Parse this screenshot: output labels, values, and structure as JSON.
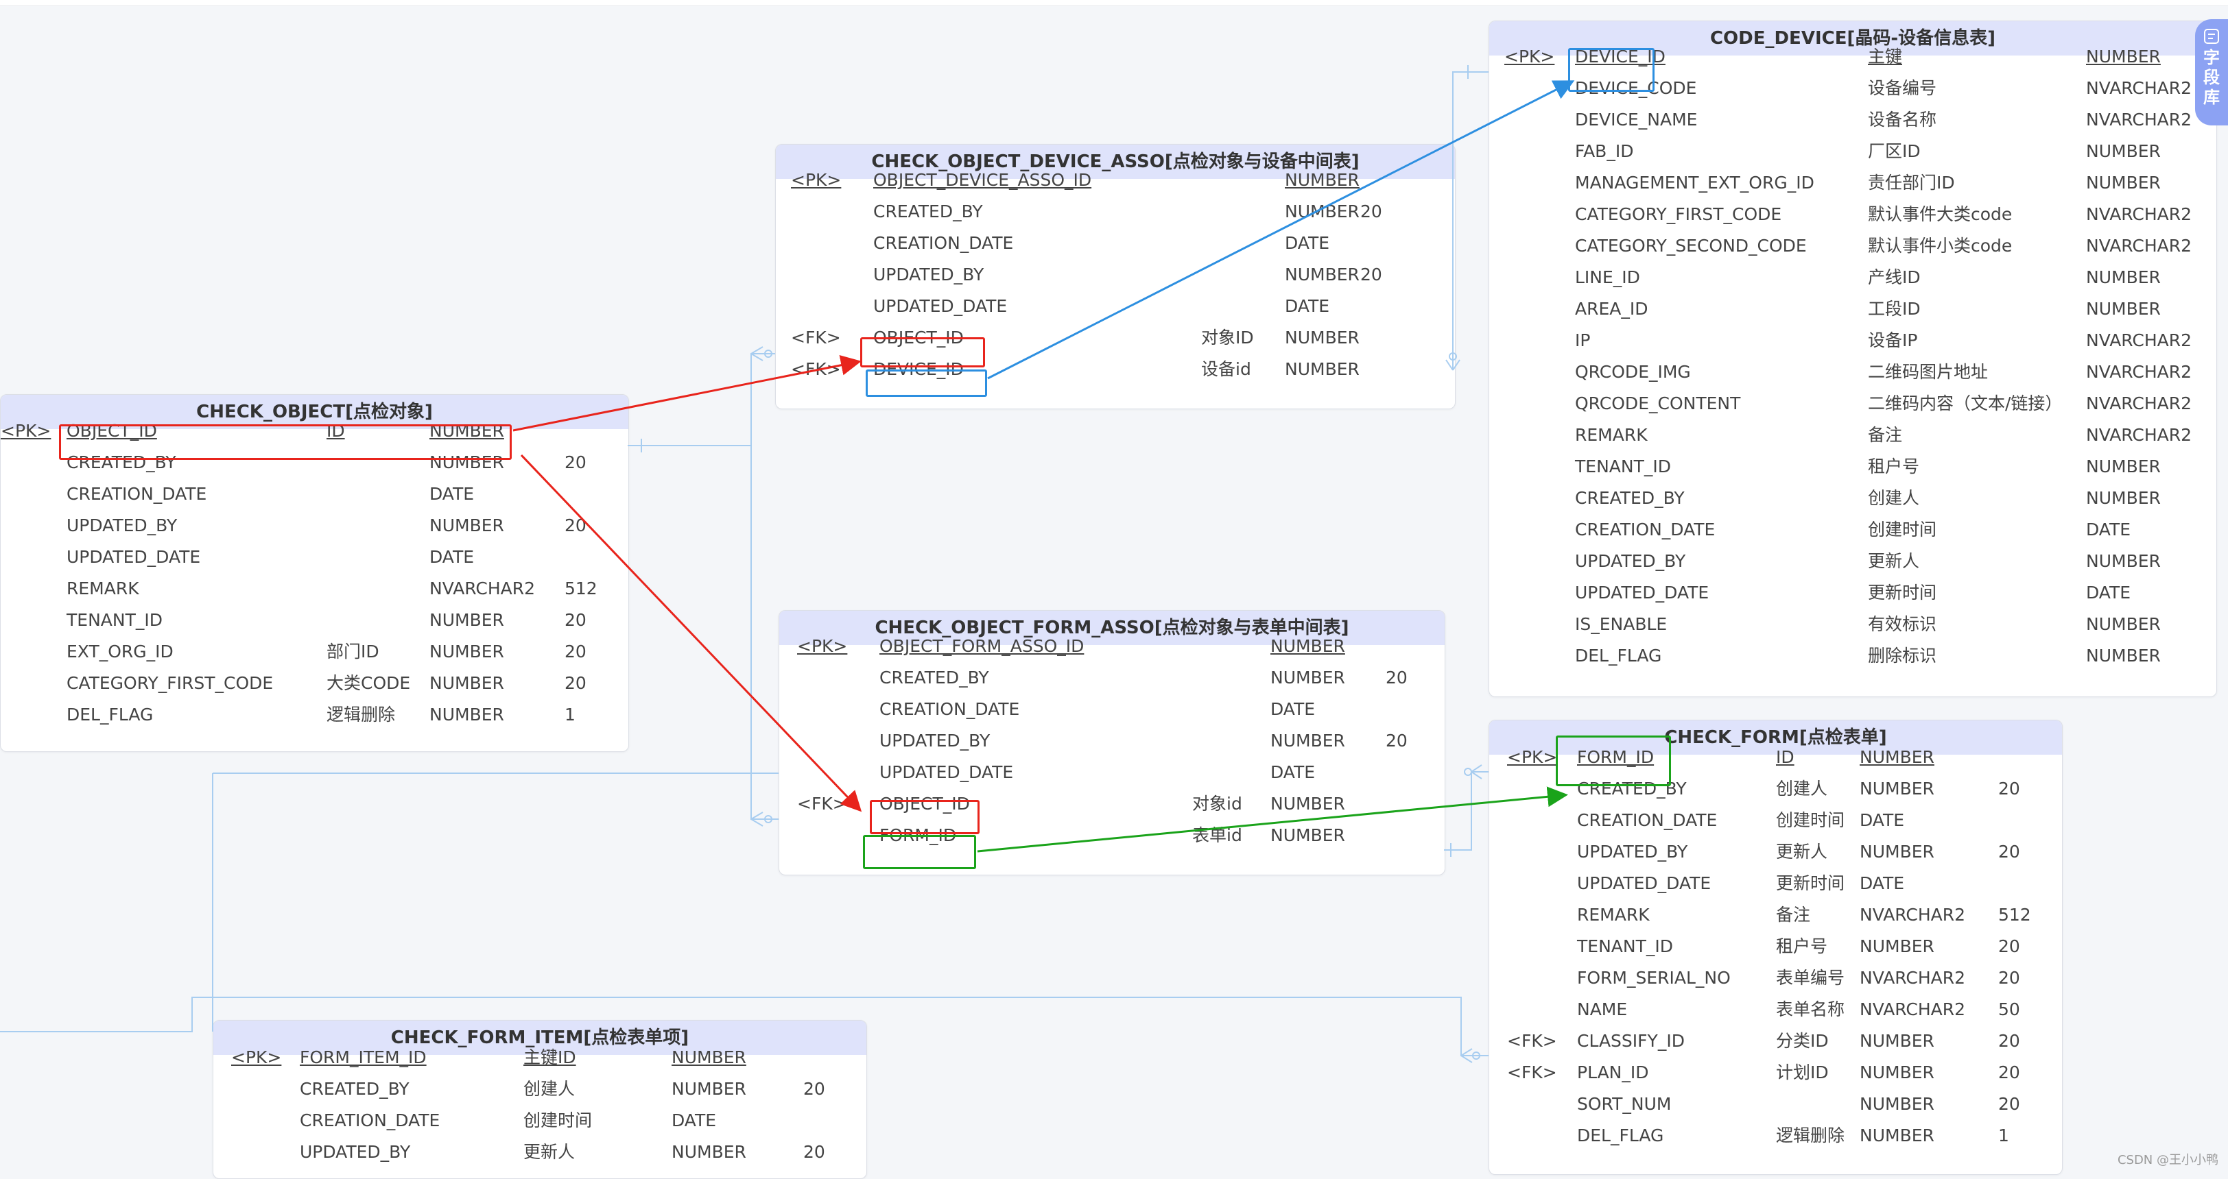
{
  "side_tab": {
    "label": "字段库",
    "icon": "database-icon"
  },
  "watermark": "CSDN @王小小鸭",
  "colors": {
    "red": "#e8241c",
    "blue": "#2d8fe0",
    "green": "#1aa31a",
    "line": "#a8cdf0"
  },
  "tables": [
    {
      "id": "check-object",
      "title": "CHECK_OBJECT[点检对象]",
      "rows": [
        {
          "key": "<PK>",
          "name": "OBJECT_ID",
          "comment": "ID",
          "type": "NUMBER",
          "len": ""
        },
        {
          "key": "",
          "name": "CREATED_BY",
          "comment": "",
          "type": "NUMBER",
          "len": "20"
        },
        {
          "key": "",
          "name": "CREATION_DATE",
          "comment": "",
          "type": "DATE",
          "len": ""
        },
        {
          "key": "",
          "name": "UPDATED_BY",
          "comment": "",
          "type": "NUMBER",
          "len": "20"
        },
        {
          "key": "",
          "name": "UPDATED_DATE",
          "comment": "",
          "type": "DATE",
          "len": ""
        },
        {
          "key": "",
          "name": "REMARK",
          "comment": "",
          "type": "NVARCHAR2",
          "len": "512"
        },
        {
          "key": "",
          "name": "TENANT_ID",
          "comment": "",
          "type": "NUMBER",
          "len": "20"
        },
        {
          "key": "",
          "name": "EXT_ORG_ID",
          "comment": "部门ID",
          "type": "NUMBER",
          "len": "20"
        },
        {
          "key": "",
          "name": "CATEGORY_FIRST_CODE",
          "comment": "大类CODE",
          "type": "NUMBER",
          "len": "20"
        },
        {
          "key": "",
          "name": "DEL_FLAG",
          "comment": "逻辑删除",
          "type": "NUMBER",
          "len": "1"
        }
      ]
    },
    {
      "id": "check-object-device-asso",
      "title": "CHECK_OBJECT_DEVICE_ASSO[点检对象与设备中间表]",
      "rows": [
        {
          "key": "<PK>",
          "name": "OBJECT_DEVICE_ASSO_ID",
          "comment": "",
          "type": "NUMBER",
          "len": ""
        },
        {
          "key": "",
          "name": "CREATED_BY",
          "comment": "",
          "type": "NUMBER",
          "len": "20"
        },
        {
          "key": "",
          "name": "CREATION_DATE",
          "comment": "",
          "type": "DATE",
          "len": ""
        },
        {
          "key": "",
          "name": "UPDATED_BY",
          "comment": "",
          "type": "NUMBER",
          "len": "20"
        },
        {
          "key": "",
          "name": "UPDATED_DATE",
          "comment": "",
          "type": "DATE",
          "len": ""
        },
        {
          "key": "<FK>",
          "name": "OBJECT_ID",
          "comment": "对象ID",
          "type": "NUMBER",
          "len": ""
        },
        {
          "key": "<FK>",
          "name": "DEVICE_ID",
          "comment": "设备id",
          "type": "NUMBER",
          "len": ""
        }
      ]
    },
    {
      "id": "code-device",
      "title": "CODE_DEVICE[晶码-设备信息表]",
      "rows": [
        {
          "key": "<PK>",
          "name": "DEVICE_ID",
          "comment": "主键",
          "type": "NUMBER",
          "len": ""
        },
        {
          "key": "",
          "name": "DEVICE_CODE",
          "comment": "设备编号",
          "type": "NVARCHAR2",
          "len": ""
        },
        {
          "key": "",
          "name": "DEVICE_NAME",
          "comment": "设备名称",
          "type": "NVARCHAR2",
          "len": ""
        },
        {
          "key": "",
          "name": "FAB_ID",
          "comment": "厂区ID",
          "type": "NUMBER",
          "len": ""
        },
        {
          "key": "",
          "name": "MANAGEMENT_EXT_ORG_ID",
          "comment": "责任部门ID",
          "type": "NUMBER",
          "len": ""
        },
        {
          "key": "",
          "name": "CATEGORY_FIRST_CODE",
          "comment": "默认事件大类code",
          "type": "NVARCHAR2",
          "len": ""
        },
        {
          "key": "",
          "name": "CATEGORY_SECOND_CODE",
          "comment": "默认事件小类code",
          "type": "NVARCHAR2",
          "len": ""
        },
        {
          "key": "",
          "name": "LINE_ID",
          "comment": "产线ID",
          "type": "NUMBER",
          "len": ""
        },
        {
          "key": "",
          "name": "AREA_ID",
          "comment": "工段ID",
          "type": "NUMBER",
          "len": ""
        },
        {
          "key": "",
          "name": "IP",
          "comment": "设备IP",
          "type": "NVARCHAR2",
          "len": ""
        },
        {
          "key": "",
          "name": "QRCODE_IMG",
          "comment": "二维码图片地址",
          "type": "NVARCHAR2",
          "len": ""
        },
        {
          "key": "",
          "name": "QRCODE_CONTENT",
          "comment": "二维码内容（文本/链接）",
          "type": "NVARCHAR2",
          "len": ""
        },
        {
          "key": "",
          "name": "REMARK",
          "comment": "备注",
          "type": "NVARCHAR2",
          "len": ""
        },
        {
          "key": "",
          "name": "TENANT_ID",
          "comment": "租户号",
          "type": "NUMBER",
          "len": ""
        },
        {
          "key": "",
          "name": "CREATED_BY",
          "comment": "创建人",
          "type": "NUMBER",
          "len": ""
        },
        {
          "key": "",
          "name": "CREATION_DATE",
          "comment": "创建时间",
          "type": "DATE",
          "len": ""
        },
        {
          "key": "",
          "name": "UPDATED_BY",
          "comment": "更新人",
          "type": "NUMBER",
          "len": ""
        },
        {
          "key": "",
          "name": "UPDATED_DATE",
          "comment": "更新时间",
          "type": "DATE",
          "len": ""
        },
        {
          "key": "",
          "name": "IS_ENABLE",
          "comment": "有效标识",
          "type": "NUMBER",
          "len": ""
        },
        {
          "key": "",
          "name": "DEL_FLAG",
          "comment": "删除标识",
          "type": "NUMBER",
          "len": ""
        }
      ]
    },
    {
      "id": "check-object-form-asso",
      "title": "CHECK_OBJECT_FORM_ASSO[点检对象与表单中间表]",
      "rows": [
        {
          "key": "<PK>",
          "name": "OBJECT_FORM_ASSO_ID",
          "comment": "",
          "type": "NUMBER",
          "len": ""
        },
        {
          "key": "",
          "name": "CREATED_BY",
          "comment": "",
          "type": "NUMBER",
          "len": "20"
        },
        {
          "key": "",
          "name": "CREATION_DATE",
          "comment": "",
          "type": "DATE",
          "len": ""
        },
        {
          "key": "",
          "name": "UPDATED_BY",
          "comment": "",
          "type": "NUMBER",
          "len": "20"
        },
        {
          "key": "",
          "name": "UPDATED_DATE",
          "comment": "",
          "type": "DATE",
          "len": ""
        },
        {
          "key": "<FK>",
          "name": "OBJECT_ID",
          "comment": "对象id",
          "type": "NUMBER",
          "len": ""
        },
        {
          "key": "",
          "name": "FORM_ID",
          "comment": "表单id",
          "type": "NUMBER",
          "len": ""
        }
      ]
    },
    {
      "id": "check-form",
      "title": "CHECK_FORM[点检表单]",
      "rows": [
        {
          "key": "<PK>",
          "name": "FORM_ID",
          "comment": "ID",
          "type": "NUMBER",
          "len": ""
        },
        {
          "key": "",
          "name": "CREATED_BY",
          "comment": "创建人",
          "type": "NUMBER",
          "len": "20"
        },
        {
          "key": "",
          "name": "CREATION_DATE",
          "comment": "创建时间",
          "type": "DATE",
          "len": ""
        },
        {
          "key": "",
          "name": "UPDATED_BY",
          "comment": "更新人",
          "type": "NUMBER",
          "len": "20"
        },
        {
          "key": "",
          "name": "UPDATED_DATE",
          "comment": "更新时间",
          "type": "DATE",
          "len": ""
        },
        {
          "key": "",
          "name": "REMARK",
          "comment": "备注",
          "type": "NVARCHAR2",
          "len": "512"
        },
        {
          "key": "",
          "name": "TENANT_ID",
          "comment": "租户号",
          "type": "NUMBER",
          "len": "20"
        },
        {
          "key": "",
          "name": "FORM_SERIAL_NO",
          "comment": "表单编号",
          "type": "NVARCHAR2",
          "len": "20"
        },
        {
          "key": "",
          "name": "NAME",
          "comment": "表单名称",
          "type": "NVARCHAR2",
          "len": "50"
        },
        {
          "key": "<FK>",
          "name": "CLASSIFY_ID",
          "comment": "分类ID",
          "type": "NUMBER",
          "len": "20"
        },
        {
          "key": "<FK>",
          "name": "PLAN_ID",
          "comment": "计划ID",
          "type": "NUMBER",
          "len": "20"
        },
        {
          "key": "",
          "name": "SORT_NUM",
          "comment": "",
          "type": "NUMBER",
          "len": "20"
        },
        {
          "key": "",
          "name": "DEL_FLAG",
          "comment": "逻辑删除",
          "type": "NUMBER",
          "len": "1"
        }
      ]
    },
    {
      "id": "check-form-item",
      "title": "CHECK_FORM_ITEM[点检表单项]",
      "rows": [
        {
          "key": "<PK>",
          "name": "FORM_ITEM_ID",
          "comment": "主键ID",
          "type": "NUMBER",
          "len": ""
        },
        {
          "key": "",
          "name": "CREATED_BY",
          "comment": "创建人",
          "type": "NUMBER",
          "len": "20"
        },
        {
          "key": "",
          "name": "CREATION_DATE",
          "comment": "创建时间",
          "type": "DATE",
          "len": ""
        },
        {
          "key": "",
          "name": "UPDATED_BY",
          "comment": "更新人",
          "type": "NUMBER",
          "len": "20"
        }
      ]
    }
  ]
}
